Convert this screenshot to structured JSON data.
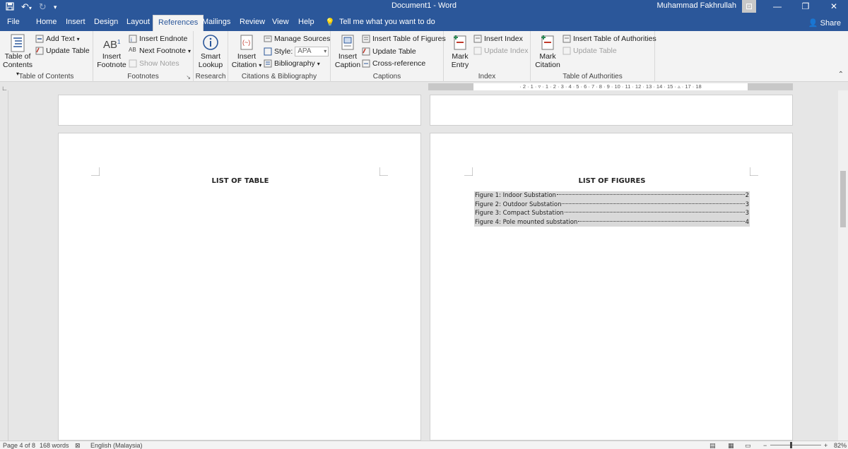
{
  "window": {
    "title": "Document1  -  Word",
    "user": "Muhammad Fakhrullah"
  },
  "tabs": [
    "File",
    "Home",
    "Insert",
    "Design",
    "Layout",
    "References",
    "Mailings",
    "Review",
    "View",
    "Help"
  ],
  "tell_me": "Tell me what you want to do",
  "share": "Share",
  "ribbon": {
    "toc_group": {
      "big_label_1": "Table of",
      "big_label_2": "Contents",
      "add_text": "Add Text",
      "update_table": "Update Table",
      "label": "Table of Contents"
    },
    "footnotes_group": {
      "insert_footnote_1": "Insert",
      "insert_footnote_2": "Footnote",
      "insert_endnote": "Insert Endnote",
      "next_footnote": "Next Footnote",
      "show_notes": "Show Notes",
      "label": "Footnotes"
    },
    "research_group": {
      "smart_lookup_1": "Smart",
      "smart_lookup_2": "Lookup",
      "label": "Research"
    },
    "citations_group": {
      "insert_citation_1": "Insert",
      "insert_citation_2": "Citation",
      "manage_sources": "Manage Sources",
      "style_label": "Style:",
      "style_value": "APA",
      "bibliography": "Bibliography",
      "label": "Citations & Bibliography"
    },
    "captions_group": {
      "insert_caption_1": "Insert",
      "insert_caption_2": "Caption",
      "insert_tof": "Insert Table of Figures",
      "update_table": "Update Table",
      "cross_reference": "Cross-reference",
      "label": "Captions"
    },
    "index_group": {
      "mark_entry_1": "Mark",
      "mark_entry_2": "Entry",
      "insert_index": "Insert Index",
      "update_index": "Update Index",
      "label": "Index"
    },
    "authorities_group": {
      "mark_citation_1": "Mark",
      "mark_citation_2": "Citation",
      "insert_toa": "Insert Table of Authorities",
      "update_table": "Update Table",
      "label": "Table of Authorities"
    }
  },
  "ruler": "· 2 · 1 · ▿ · 1 · 2 · 3 · 4 · 5 · 6 · 7 · 8 · 9 · 10 · 11 · 12 · 13 · 14 · 15 · ▵ · 17 · 18",
  "pages": {
    "left": {
      "heading": "LIST OF TABLE"
    },
    "right": {
      "heading": "LIST OF FIGURES",
      "entries": [
        {
          "text": "Figure 1: Indoor Substation",
          "page": "2"
        },
        {
          "text": "Figure 2: Outdoor Substation",
          "page": "3"
        },
        {
          "text": "Figure 3: Compact Substation",
          "page": "3"
        },
        {
          "text": "Figure 4: Pole mounted substation",
          "page": "4"
        }
      ]
    }
  },
  "status": {
    "page": "Page 4 of 8",
    "words": "168 words",
    "language": "English (Malaysia)",
    "zoom": "82%"
  }
}
